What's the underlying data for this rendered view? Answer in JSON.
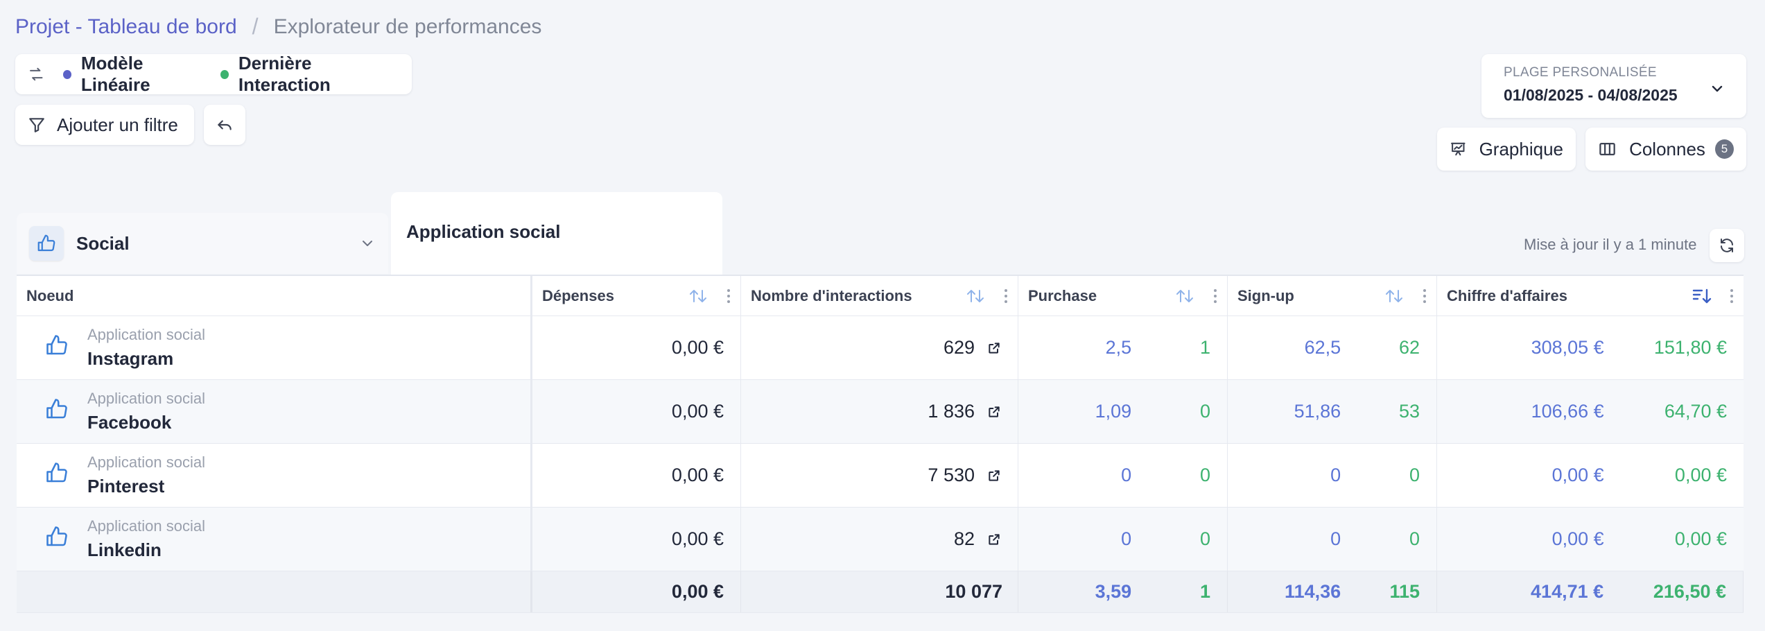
{
  "breadcrumb": {
    "project": "Projet - Tableau de bord",
    "separator": "/",
    "current": "Explorateur de performances"
  },
  "models": {
    "primary": "Modèle Linéaire",
    "primary_color": "#5b62c7",
    "secondary": "Dernière Interaction",
    "secondary_color": "#3db26f"
  },
  "toolbar": {
    "add_filter": "Ajouter un filtre",
    "chart": "Graphique",
    "columns": "Colonnes",
    "columns_count": "5"
  },
  "date_range": {
    "label": "PLAGE PERSONALISÉE",
    "value": "01/08/2025 - 04/08/2025"
  },
  "tabs": {
    "social": "Social",
    "app": "Application social"
  },
  "update_status": "Mise à jour il y a 1 minute",
  "table": {
    "headers": {
      "node": "Noeud",
      "spend": "Dépenses",
      "interactions": "Nombre d'interactions",
      "purchase": "Purchase",
      "signup": "Sign-up",
      "revenue": "Chiffre d'affaires"
    },
    "rows": [
      {
        "category": "Application social",
        "name": "Instagram",
        "spend": "0,00 €",
        "interactions": "629",
        "purchase_a": "2,5",
        "purchase_b": "1",
        "signup_a": "62,5",
        "signup_b": "62",
        "revenue_a": "308,05 €",
        "revenue_b": "151,80 €"
      },
      {
        "category": "Application social",
        "name": "Facebook",
        "spend": "0,00 €",
        "interactions": "1 836",
        "purchase_a": "1,09",
        "purchase_b": "0",
        "signup_a": "51,86",
        "signup_b": "53",
        "revenue_a": "106,66 €",
        "revenue_b": "64,70 €"
      },
      {
        "category": "Application social",
        "name": "Pinterest",
        "spend": "0,00 €",
        "interactions": "7 530",
        "purchase_a": "0",
        "purchase_b": "0",
        "signup_a": "0",
        "signup_b": "0",
        "revenue_a": "0,00 €",
        "revenue_b": "0,00 €"
      },
      {
        "category": "Application social",
        "name": "Linkedin",
        "spend": "0,00 €",
        "interactions": "82",
        "purchase_a": "0",
        "purchase_b": "0",
        "signup_a": "0",
        "signup_b": "0",
        "revenue_a": "0,00 €",
        "revenue_b": "0,00 €"
      }
    ],
    "totals": {
      "spend": "0,00 €",
      "interactions": "10 077",
      "purchase_a": "3,59",
      "purchase_b": "1",
      "signup_a": "114,36",
      "signup_b": "115",
      "revenue_a": "414,71 €",
      "revenue_b": "216,50 €"
    }
  }
}
